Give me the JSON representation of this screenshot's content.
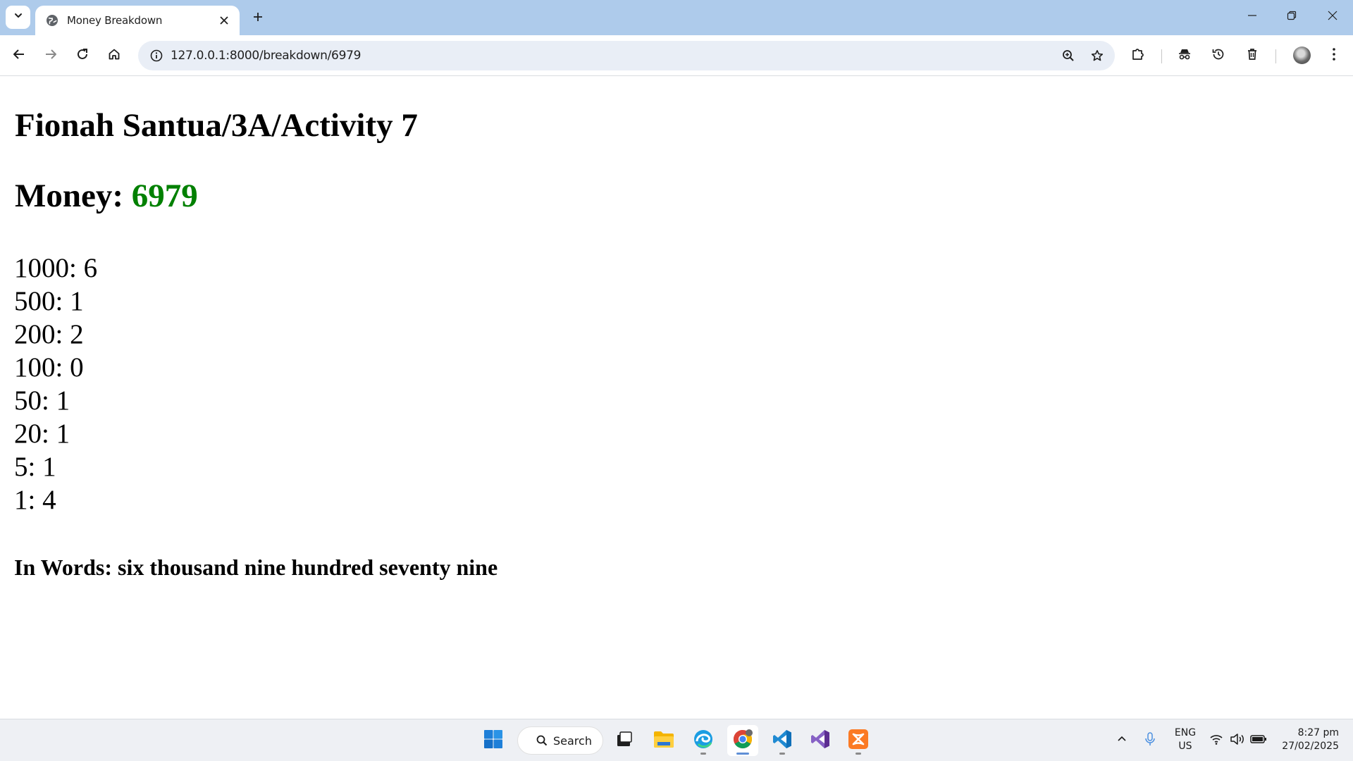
{
  "browser": {
    "tab": {
      "title": "Money Breakdown",
      "favicon": "globe-icon"
    },
    "omnibox": {
      "url": "127.0.0.1:8000/breakdown/6979"
    }
  },
  "page": {
    "title": "Fionah Santua/3A/Activity 7",
    "money_label": "Money: ",
    "money_value": "6979",
    "money_value_color": "#008000",
    "breakdown": [
      {
        "denomination": "1000",
        "count": "6"
      },
      {
        "denomination": "500",
        "count": "1"
      },
      {
        "denomination": "200",
        "count": "2"
      },
      {
        "denomination": "100",
        "count": "0"
      },
      {
        "denomination": "50",
        "count": "1"
      },
      {
        "denomination": "20",
        "count": "1"
      },
      {
        "denomination": "5",
        "count": "1"
      },
      {
        "denomination": "1",
        "count": "4"
      }
    ],
    "in_words": "In Words: six thousand nine hundred seventy nine"
  },
  "taskbar": {
    "search_label": "Search",
    "lang_line1": "ENG",
    "lang_line2": "US",
    "time": "8:27 pm",
    "date": "27/02/2025"
  }
}
